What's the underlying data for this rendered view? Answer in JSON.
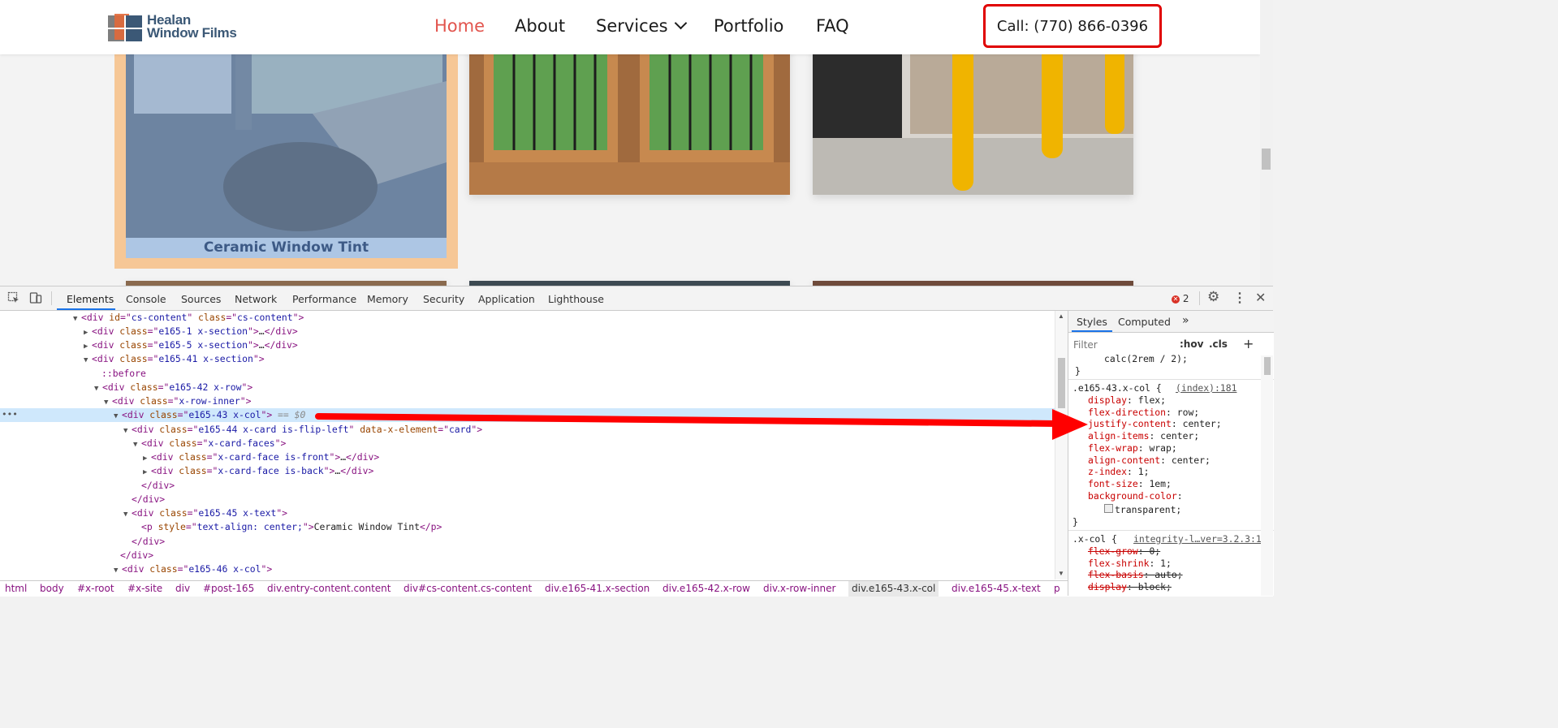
{
  "site": {
    "logo": {
      "line1": "Healan",
      "line2": "Window Films"
    },
    "nav": [
      {
        "label": "Home",
        "active": true
      },
      {
        "label": "About",
        "active": false
      },
      {
        "label": "Services",
        "active": false,
        "has_dropdown": true
      },
      {
        "label": "Portfolio",
        "active": false
      },
      {
        "label": "FAQ",
        "active": false
      }
    ],
    "call_button": "Call: (770) 866-0396",
    "card_caption": "Ceramic Window Tint",
    "colors": {
      "active_nav": "#e2554e",
      "call_border": "#e00000",
      "highlight_margin": "#f6c796",
      "highlight_content": "#a6c6ea"
    }
  },
  "devtools": {
    "tabs": [
      "Elements",
      "Console",
      "Sources",
      "Network",
      "Performance",
      "Memory",
      "Security",
      "Application",
      "Lighthouse"
    ],
    "active_tab": "Elements",
    "error_count": "2",
    "dom_lines": [
      {
        "parts": [
          [
            "tri",
            "▼"
          ],
          [
            "tg",
            "<div"
          ],
          [
            "an",
            " id"
          ],
          [
            "tg",
            "=\""
          ],
          [
            "av",
            "cs-content"
          ],
          [
            "tg",
            "\""
          ],
          [
            "an",
            " class"
          ],
          [
            "tg",
            "=\""
          ],
          [
            "av",
            "cs-content"
          ],
          [
            "tg",
            "\">"
          ]
        ]
      },
      {
        "parts": [
          [
            "tri",
            "▶"
          ],
          [
            "tg",
            "<div"
          ],
          [
            "an",
            " class"
          ],
          [
            "tg",
            "=\""
          ],
          [
            "av",
            "e165-1 x-section"
          ],
          [
            "tg",
            "\">"
          ],
          [
            "tx",
            "…"
          ],
          [
            "tg",
            "</div>"
          ]
        ]
      },
      {
        "parts": [
          [
            "tri",
            "▶"
          ],
          [
            "tg",
            "<div"
          ],
          [
            "an",
            " class"
          ],
          [
            "tg",
            "=\""
          ],
          [
            "av",
            "e165-5 x-section"
          ],
          [
            "tg",
            "\">"
          ],
          [
            "tx",
            "…"
          ],
          [
            "tg",
            "</div>"
          ]
        ]
      },
      {
        "parts": [
          [
            "tri",
            "▼"
          ],
          [
            "tg",
            "<div"
          ],
          [
            "an",
            " class"
          ],
          [
            "tg",
            "=\""
          ],
          [
            "av",
            "e165-41 x-section"
          ],
          [
            "tg",
            "\">"
          ]
        ]
      },
      {
        "parts": [
          [
            "ps",
            "::before"
          ]
        ]
      },
      {
        "parts": [
          [
            "tri",
            "▼"
          ],
          [
            "tg",
            "<div"
          ],
          [
            "an",
            " class"
          ],
          [
            "tg",
            "=\""
          ],
          [
            "av",
            "e165-42 x-row"
          ],
          [
            "tg",
            "\">"
          ]
        ]
      },
      {
        "parts": [
          [
            "tri",
            "▼"
          ],
          [
            "tg",
            "<div"
          ],
          [
            "an",
            " class"
          ],
          [
            "tg",
            "=\""
          ],
          [
            "av",
            "x-row-inner"
          ],
          [
            "tg",
            "\">"
          ]
        ]
      },
      {
        "parts": [
          [
            "tri",
            "▼"
          ],
          [
            "tg",
            "<div"
          ],
          [
            "an",
            " class"
          ],
          [
            "tg",
            "=\""
          ],
          [
            "av",
            "e165-43 x-col"
          ],
          [
            "tg",
            "\">"
          ],
          [
            "dim",
            " == $0"
          ]
        ],
        "selected": true
      },
      {
        "parts": [
          [
            "tri",
            "▼"
          ],
          [
            "tg",
            "<div"
          ],
          [
            "an",
            " class"
          ],
          [
            "tg",
            "=\""
          ],
          [
            "av",
            "e165-44 x-card is-flip-left"
          ],
          [
            "tg",
            "\""
          ],
          [
            "an",
            " data-x-element"
          ],
          [
            "tg",
            "=\""
          ],
          [
            "av",
            "card"
          ],
          [
            "tg",
            "\">"
          ]
        ]
      },
      {
        "parts": [
          [
            "tri",
            "▼"
          ],
          [
            "tg",
            "<div"
          ],
          [
            "an",
            " class"
          ],
          [
            "tg",
            "=\""
          ],
          [
            "av",
            "x-card-faces"
          ],
          [
            "tg",
            "\">"
          ]
        ]
      },
      {
        "parts": [
          [
            "tri",
            "▶"
          ],
          [
            "tg",
            "<div"
          ],
          [
            "an",
            " class"
          ],
          [
            "tg",
            "=\""
          ],
          [
            "av",
            "x-card-face is-front"
          ],
          [
            "tg",
            "\">"
          ],
          [
            "tx",
            "…"
          ],
          [
            "tg",
            "</div>"
          ]
        ]
      },
      {
        "parts": [
          [
            "tri",
            "▶"
          ],
          [
            "tg",
            "<div"
          ],
          [
            "an",
            " class"
          ],
          [
            "tg",
            "=\""
          ],
          [
            "av",
            "x-card-face is-back"
          ],
          [
            "tg",
            "\">"
          ],
          [
            "tx",
            "…"
          ],
          [
            "tg",
            "</div>"
          ]
        ]
      },
      {
        "parts": [
          [
            "tg",
            "</div>"
          ]
        ]
      },
      {
        "parts": [
          [
            "tg",
            "</div>"
          ]
        ]
      },
      {
        "parts": [
          [
            "tri",
            "▼"
          ],
          [
            "tg",
            "<div"
          ],
          [
            "an",
            " class"
          ],
          [
            "tg",
            "=\""
          ],
          [
            "av",
            "e165-45 x-text"
          ],
          [
            "tg",
            "\">"
          ]
        ]
      },
      {
        "parts": [
          [
            "tg",
            "<p"
          ],
          [
            "an",
            " style"
          ],
          [
            "tg",
            "=\""
          ],
          [
            "av",
            "text-align: center;"
          ],
          [
            "tg",
            "\">"
          ],
          [
            "tx",
            "Ceramic Window Tint"
          ],
          [
            "tg",
            "</p>"
          ]
        ]
      },
      {
        "parts": [
          [
            "tg",
            "</div>"
          ]
        ]
      },
      {
        "parts": [
          [
            "tg",
            "</div>"
          ]
        ]
      },
      {
        "parts": [
          [
            "tri",
            "▼"
          ],
          [
            "tg",
            "<div"
          ],
          [
            "an",
            " class"
          ],
          [
            "tg",
            "=\""
          ],
          [
            "av",
            "e165-46 x-col"
          ],
          [
            "tg",
            "\">"
          ]
        ]
      }
    ],
    "breadcrumbs": [
      "html",
      "body",
      "#x-root",
      "#x-site",
      "div",
      "#post-165",
      "div.entry-content.content",
      "div#cs-content.cs-content",
      "div.e165-41.x-section",
      "div.e165-42.x-row",
      "div.x-row-inner",
      "div.e165-43.x-col",
      "div.e165-45.x-text",
      "p"
    ],
    "selected_crumb": "div.e165-43.x-col",
    "styles": {
      "tabs": [
        "Styles",
        "Computed",
        "»"
      ],
      "filter_placeholder": "Filter",
      "hov": ":hov",
      "cls": ".cls",
      "add": "+",
      "prev_value": "calc(2rem / 2);",
      "close_brace": "}",
      "rule1": {
        "selector": ".e165-43.x-col {",
        "source": "(index):181",
        "props": [
          {
            "name": "display",
            "value": "flex;"
          },
          {
            "name": "flex-direction",
            "value": "row;"
          },
          {
            "name": "justify-content",
            "value": "center;"
          },
          {
            "name": "align-items",
            "value": "center;"
          },
          {
            "name": "flex-wrap",
            "value": "wrap;"
          },
          {
            "name": "align-content",
            "value": "center;"
          },
          {
            "name": "z-index",
            "value": "1;"
          },
          {
            "name": "font-size",
            "value": "1em;"
          },
          {
            "name": "background-color",
            "value": ""
          }
        ],
        "bg_value": "transparent;"
      },
      "rule2": {
        "selector": ".x-col {",
        "source": "integrity-l…ver=3.2.3:1",
        "props": [
          {
            "name": "flex-grow",
            "value": "0;",
            "struck": true
          },
          {
            "name": "flex-shrink",
            "value": "1;",
            "struck": false
          },
          {
            "name": "flex-basis",
            "value": "auto;",
            "struck": true
          },
          {
            "name": "display",
            "value": "block;",
            "struck": true
          }
        ]
      }
    }
  }
}
